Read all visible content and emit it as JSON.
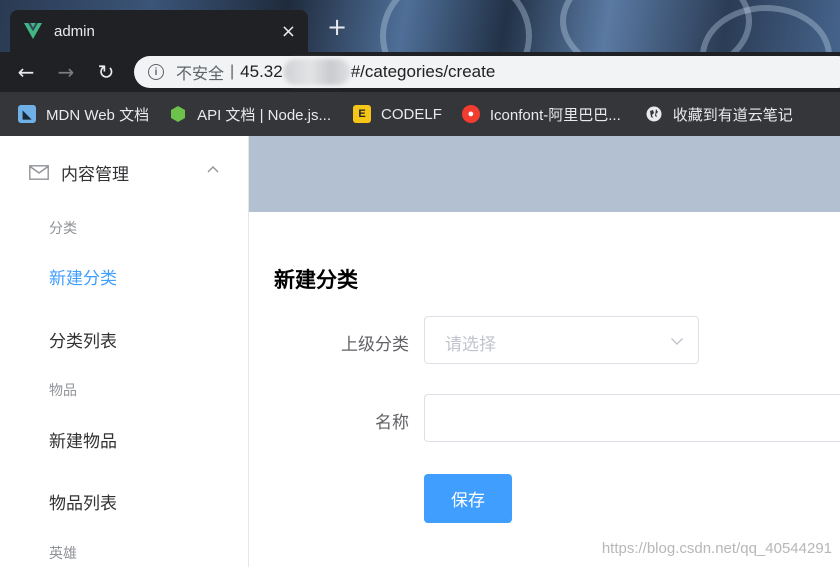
{
  "browser": {
    "tab_title": "admin",
    "close_glyph": "×",
    "new_tab_glyph": "+",
    "nav": {
      "back": "←",
      "forward": "→",
      "reload": "↻"
    },
    "address": {
      "security_label": "不安全",
      "separator": "|",
      "url_prefix": "45.32",
      "url_suffix": "#/categories/create"
    },
    "bookmarks": [
      {
        "label": "MDN Web 文档",
        "icon": "mdn-icon",
        "color": "#6fb0e6"
      },
      {
        "label": "API 文档 | Node.js...",
        "icon": "nodejs-icon",
        "color": "#6cc24a"
      },
      {
        "label": "CODELF",
        "icon": "codelf-icon",
        "color": "#f5c518"
      },
      {
        "label": "Iconfont-阿里巴巴...",
        "icon": "iconfont-icon",
        "color": "#f23c2f"
      },
      {
        "label": "收藏到有道云笔记",
        "icon": "globe-icon",
        "color": "#e8eaed"
      }
    ]
  },
  "sidebar": {
    "submenu_title": "内容管理",
    "groups": [
      {
        "title": "分类",
        "items": [
          "新建分类",
          "分类列表"
        ]
      },
      {
        "title": "物品",
        "items": [
          "新建物品",
          "物品列表"
        ]
      },
      {
        "title": "英雄",
        "items": []
      }
    ],
    "active_item": "新建分类"
  },
  "main": {
    "page_title": "新建分类",
    "form": {
      "parent_label": "上级分类",
      "parent_placeholder": "请选择",
      "name_label": "名称",
      "name_value": "",
      "save_label": "保存"
    }
  },
  "watermark": "https://blog.csdn.net/qq_40544291",
  "colors": {
    "accent": "#409eff",
    "header_band": "#b3c0d1",
    "chrome_dark": "#202124"
  }
}
